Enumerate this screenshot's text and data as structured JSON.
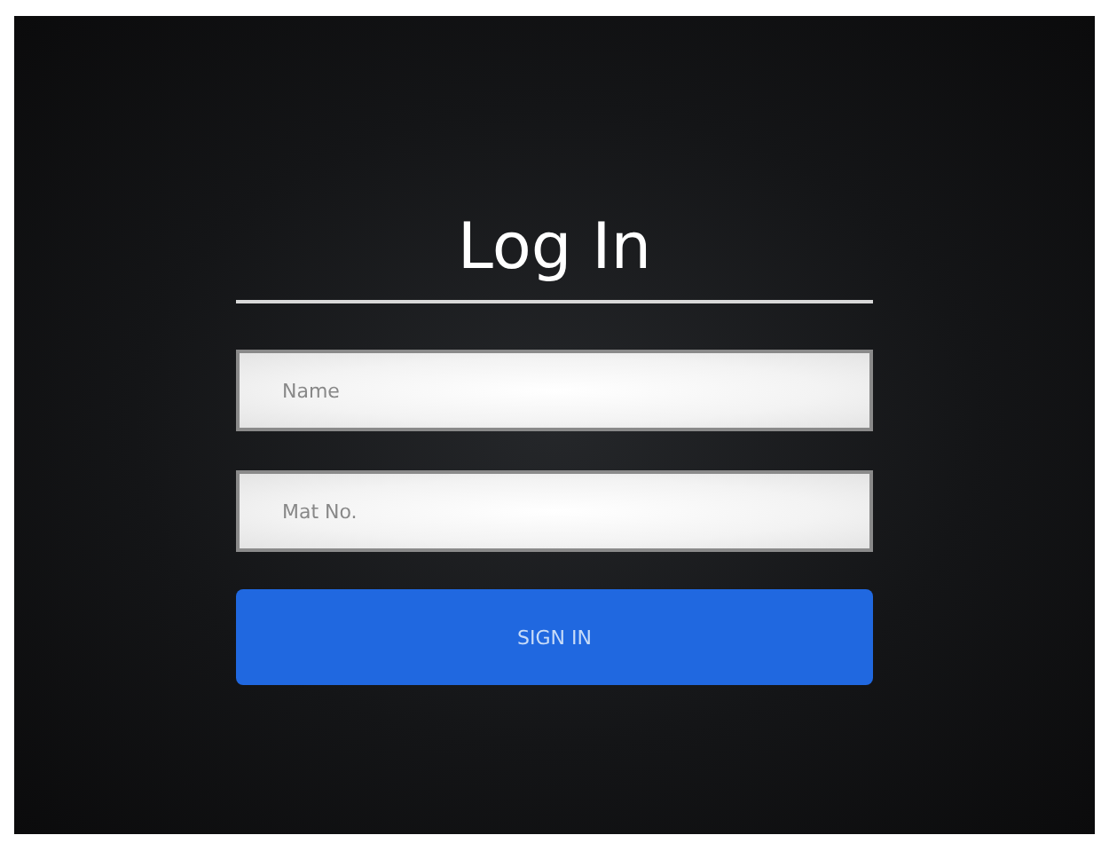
{
  "title": "Log In",
  "fields": [
    {
      "placeholder": "Name"
    },
    {
      "placeholder": "Mat No."
    }
  ],
  "button": "SIGN IN"
}
